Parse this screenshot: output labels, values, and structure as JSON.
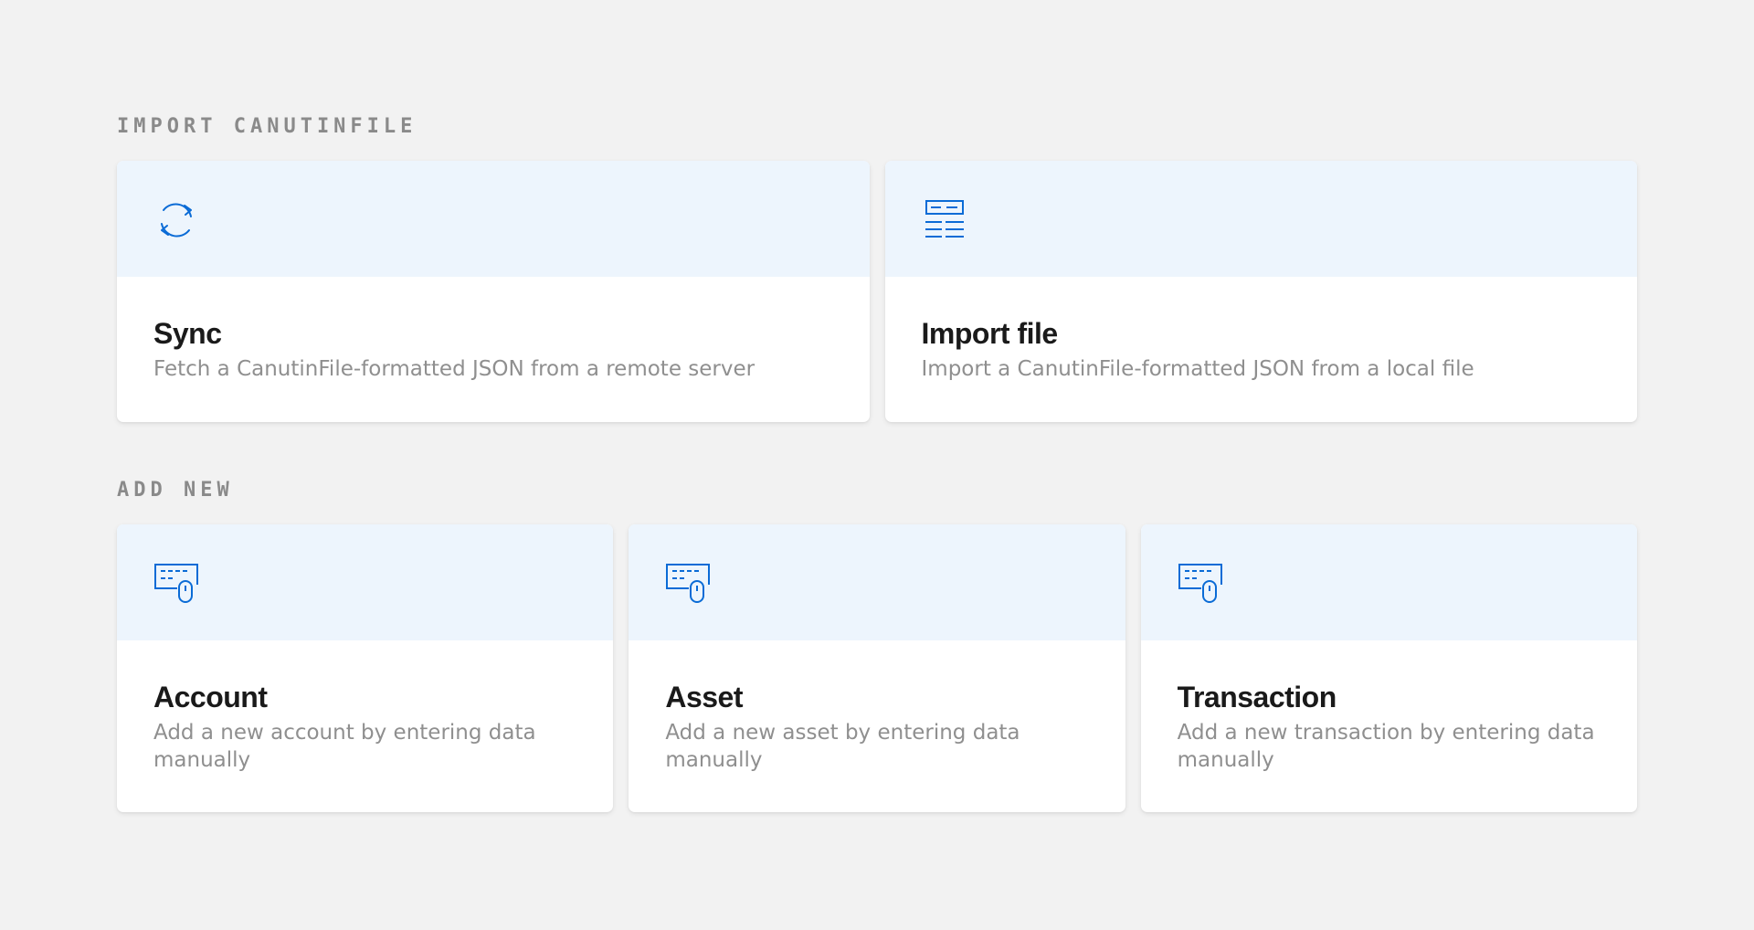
{
  "sections": {
    "import": {
      "title": "Import CanutinFile",
      "cards": [
        {
          "title": "Sync",
          "description": "Fetch a CanutinFile-formatted JSON from a remote server",
          "icon": "sync-icon"
        },
        {
          "title": "Import file",
          "description": "Import a CanutinFile-formatted JSON from a local file",
          "icon": "document-icon"
        }
      ]
    },
    "add": {
      "title": "Add new",
      "cards": [
        {
          "title": "Account",
          "description": "Add a new account by entering data manually",
          "icon": "keyboard-mouse-icon"
        },
        {
          "title": "Asset",
          "description": "Add a new asset by entering data manually",
          "icon": "keyboard-mouse-icon"
        },
        {
          "title": "Transaction",
          "description": "Add a new transaction by entering data manually",
          "icon": "keyboard-mouse-icon"
        }
      ]
    }
  },
  "colors": {
    "background": "#f2f2f2",
    "card_header": "#edf5fd",
    "accent": "#0a6bd6",
    "heading": "#1a1a1a",
    "muted": "#8f8f8f"
  }
}
